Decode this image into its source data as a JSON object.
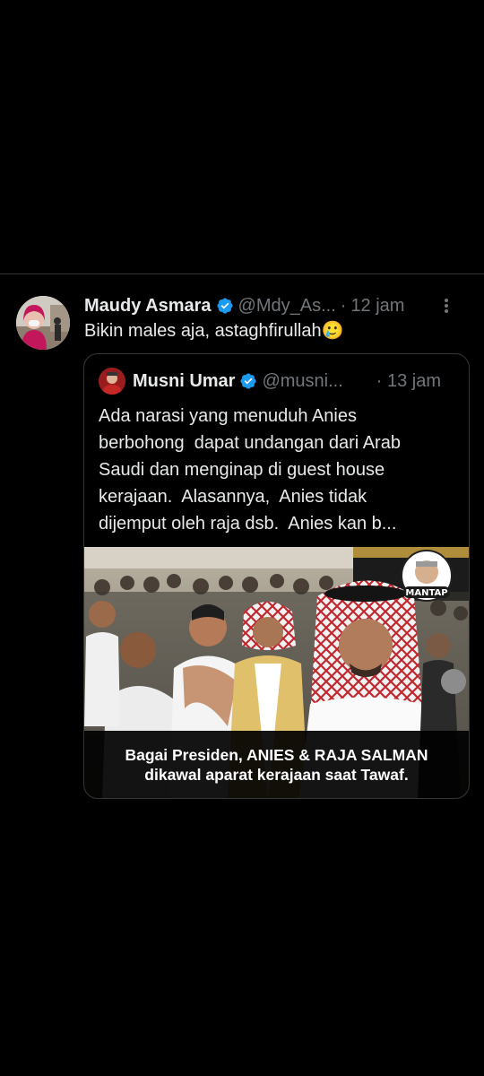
{
  "tweet": {
    "author_name": "Maudy Asmara",
    "handle": "@Mdy_As...",
    "separator": "·",
    "time": "12 jam",
    "text": "Bikin males aja, astaghfirullah",
    "emoji": "🥲"
  },
  "quoted_tweet": {
    "author_name": "Musni Umar",
    "handle": "@musni...",
    "separator": "·",
    "time": "13 jam",
    "text_lines": [
      "Ada narasi yang menuduh Anies",
      "berbohong  dapat undangan dari Arab",
      "Saudi dan menginap di guest house",
      "kerajaan.  Alasannya,  Anies tidak",
      "dijemput oleh raja dsb.  Anies kan b..."
    ],
    "media": {
      "badge": "MANTAP",
      "caption_lines": [
        "Bagai Presiden, ANIES & RAJA SALMAN",
        "dikawal aparat kerajaan saat Tawaf."
      ]
    }
  },
  "icons": {
    "verified": "verified-badge-icon",
    "more": "more-options-icon"
  },
  "colors": {
    "background": "#000000",
    "text_primary": "#e7e9ea",
    "text_muted": "#71767b",
    "verified_blue": "#1d9bf0",
    "border": "#333639"
  }
}
